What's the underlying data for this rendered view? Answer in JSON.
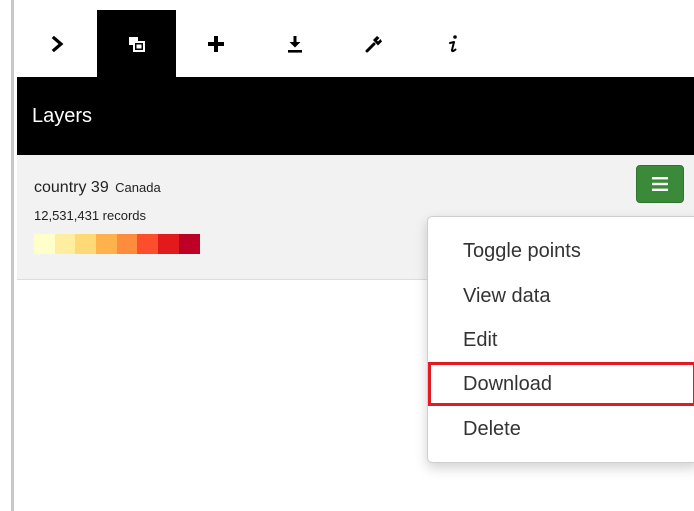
{
  "toolbar": {
    "items": [
      {
        "icon": "chevron-right-icon",
        "active": false
      },
      {
        "icon": "layers-icon",
        "active": true
      },
      {
        "icon": "plus-icon",
        "active": false
      },
      {
        "icon": "download-icon",
        "active": false
      },
      {
        "icon": "wrench-icon",
        "active": false
      },
      {
        "icon": "info-icon",
        "active": false
      }
    ]
  },
  "header": {
    "title": "Layers"
  },
  "layer": {
    "name": "country 39",
    "region": "Canada",
    "records": "12,531,431 records",
    "legend_colors": [
      "#ffffcc",
      "#ffeda0",
      "#fed976",
      "#feb24c",
      "#fd8d3c",
      "#fc4e2a",
      "#e31a1c",
      "#bd0026"
    ],
    "menu_button_color": "#3a8a3a"
  },
  "dropdown": {
    "items": [
      "Toggle points",
      "View data",
      "Edit",
      "Download",
      "Delete"
    ],
    "highlighted": "Download",
    "highlight_color": "#e21b23"
  }
}
